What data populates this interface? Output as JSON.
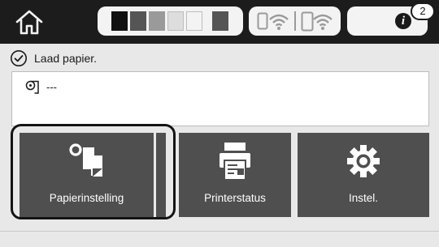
{
  "topbar": {
    "home_icon": "home-icon",
    "ink_levels": [
      {
        "color": "#111111"
      },
      {
        "color": "#555555"
      },
      {
        "color": "#9a9a9a"
      },
      {
        "color": "#dddddd"
      },
      {
        "color": "#f3f3f3"
      },
      {
        "color": "#555555"
      }
    ],
    "wired_icon": "wired-network-icon",
    "wifi_icon": "wifi-icon",
    "wifi_direct_icon": "wifi-direct-icon",
    "info_icon": "info-icon",
    "info_glyph": "i",
    "notification_count": "2"
  },
  "status": {
    "icon": "check-circle-icon",
    "message": "Laad papier."
  },
  "paper_panel": {
    "icon": "paper-roll-icon",
    "paper_type": "---"
  },
  "menu": {
    "tiles": [
      {
        "label": "Papierinstelling",
        "icon": "paper-settings-icon"
      },
      {
        "label": "Printerstatus",
        "icon": "printer-icon"
      },
      {
        "label": "Instel.",
        "icon": "gear-icon"
      }
    ]
  },
  "colors": {
    "topbar": "#1c1c1c",
    "tile": "#4f4f4f",
    "background": "#e8e8e8"
  }
}
